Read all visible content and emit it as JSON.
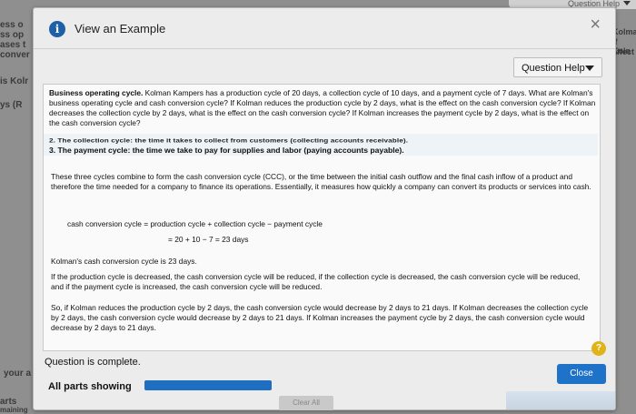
{
  "background": {
    "left_fragments": [
      "ess o",
      "ss op",
      "ases t",
      "conver",
      "is Kolr",
      "ys (R",
      "your a",
      "arts",
      "maining"
    ],
    "right_fragments": [
      "Kolma",
      "If Koln",
      "affect"
    ],
    "top_right": "Question Help"
  },
  "dialog": {
    "title": "View an Example",
    "info_icon": "i",
    "close_icon": "×",
    "question_help_label": "Question Help",
    "problem": {
      "heading": "Business operating cycle.",
      "text": "Kolman Kampers has a production cycle of 20 days, a collection cycle of 10 days, and a payment cycle of 7 days. What are Kolman's business operating cycle and cash conversion cycle? If Kolman reduces the production cycle by 2 days, what is the effect on the cash conversion cycle? If Kolman decreases the collection cycle by 2 days, what is the effect on the cash conversion cycle? If Kolman increases the payment cycle by 2 days, what is the effect on the cash conversion cycle?"
    },
    "cut_line": "2. The collection cycle: the time it takes to collect from customers (collecting accounts receivable).",
    "item3": "3. The payment cycle: the time we take to pay for supplies and labor (paying accounts payable).",
    "para1": "These three cycles combine to form the cash conversion cycle (CCC), or the time between the initial cash outflow and the final cash inflow of a product and therefore the time needed for a company to finance its operations. Essentially, it measures how quickly a company can convert its products or services into cash.",
    "formula_line1": "cash conversion cycle = production cycle + collection cycle − payment cycle",
    "formula_line2": "= 20 + 10 − 7 = 23 days",
    "result": "Kolman's cash conversion cycle is 23 days.",
    "para2": "If the production cycle is decreased, the cash conversion cycle will be reduced, if the collection cycle is decreased, the cash conversion cycle will be reduced, and if the payment cycle is increased, the cash conversion cycle will be reduced.",
    "para3": "So, if Kolman reduces the production cycle by 2 days, the cash conversion cycle would decrease by 2 days to 21 days. If Kolman decreases the collection cycle by 2 days, the cash conversion cycle would decrease by 2 days to 21 days. If Kolman increases the payment cycle by 2 days, the cash conversion cycle would decrease by 2 days to 21 days.",
    "complete_text": "Question is complete.",
    "help_icon": "?",
    "close_button": "Close",
    "all_parts": "All parts showing",
    "ghost_button": "Clear All"
  },
  "colors": {
    "accent": "#1e73c8",
    "help": "#e0b318"
  }
}
